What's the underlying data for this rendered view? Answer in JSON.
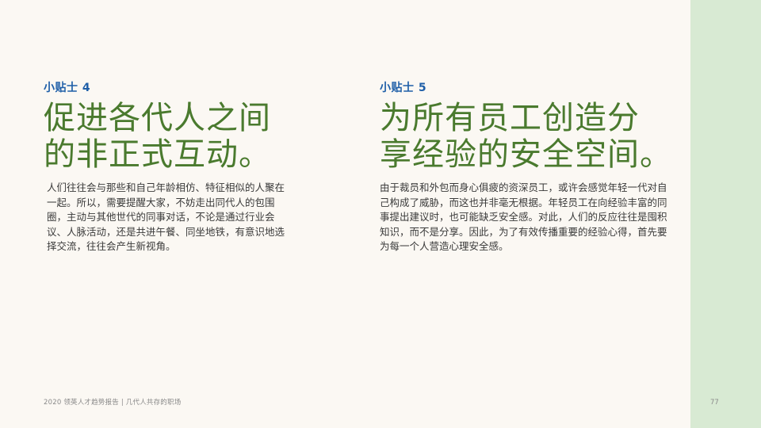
{
  "tips": [
    {
      "label": "小贴士 4",
      "title_line1": "促进各代人之间",
      "title_line2": "的非正式互动。",
      "body": "人们往往会与那些和自己年龄相仿、特征相似的人聚在一起。所以，需要提醒大家，不妨走出同代人的包围圈，主动与其他世代的同事对话，不论是通过行业会议、人脉活动，还是共进午餐、同坐地铁，有意识地选择交流，往往会产生新视角。"
    },
    {
      "label": "小贴士 5",
      "title_line1": "为所有员工创造分",
      "title_line2": "享经验的安全空间。",
      "body": "由于裁员和外包而身心俱疲的资深员工，或许会感觉年轻一代对自己构成了威胁，而这也并非毫无根据。年轻员工在向经验丰富的同事提出建议时，也可能缺乏安全感。对此，人们的反应往往是囤积知识，而不是分享。因此，为了有效传播重要的经验心得，首先要为每一个人营造心理安全感。"
    }
  ],
  "footer": {
    "text": "2020 领英人才趋势报告 | 几代人共存的职场",
    "page_number": "77"
  },
  "colors": {
    "background": "#fbf8f3",
    "side_band": "#d8ead3",
    "label": "#1f5fa8",
    "title": "#4a7a2e",
    "body": "#3a3a3a"
  }
}
